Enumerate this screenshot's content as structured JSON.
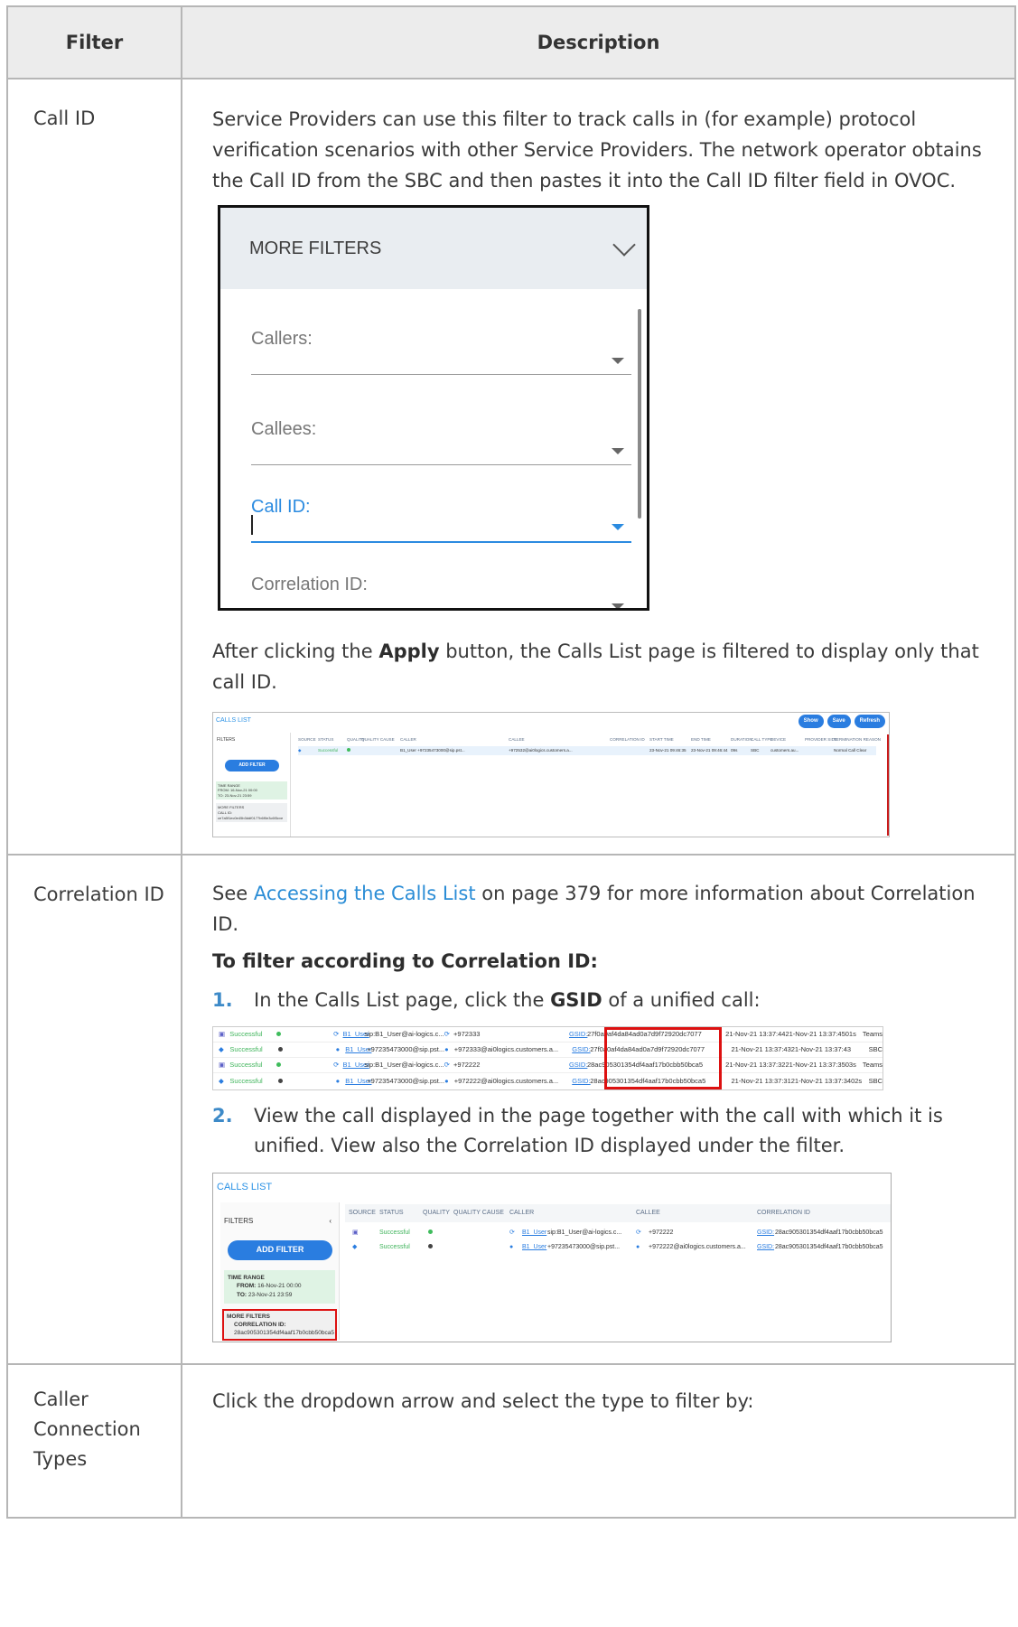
{
  "table": {
    "col_filter": "Filter",
    "col_description": "Description"
  },
  "rows": {
    "call_id": {
      "name": "Call ID",
      "para1": "Service Providers can use this filter to track calls in (for example) protocol verification scenarios with other Service Providers. The network operator obtains the Call ID from the SBC and then pastes it into the Call ID filter field in OVOC.",
      "para2_pre": "After clicking the ",
      "para2_bold": "Apply",
      "para2_post": " button, the Calls List page is filtered to display only that call ID."
    },
    "correlation_id": {
      "name": "Correlation ID",
      "see_pre": "See ",
      "see_link": "Accessing the Calls List",
      "see_post": " on page 379 for more information about Correlation ID.",
      "heading": "To filter according to Correlation ID:",
      "step1_num": "1.",
      "step1_pre": "In the Calls List page, click the ",
      "step1_bold": "GSID",
      "step1_post": " of a unified call:",
      "step2_num": "2.",
      "step2_text": "View the call displayed in the page together with the call with which it is unified. View also the Correlation ID displayed under the filter."
    },
    "caller_conn": {
      "name_l1": "Caller",
      "name_l2": "Connection",
      "name_l3": "Types",
      "text": "Click the dropdown arrow and select the type to filter by:"
    }
  },
  "more_filters": {
    "title": "MORE FILTERS",
    "fields": [
      "Callers:",
      "Callees:",
      "Call ID:",
      "Correlation ID:"
    ]
  },
  "calls_list_1": {
    "title": "CALLS LIST",
    "buttons": [
      "Show",
      "Save",
      "Refresh"
    ],
    "filters_label": "FILTERS",
    "add_filter": "ADD FILTER",
    "time_range": "TIME RANGE",
    "from": "FROM: 16-Nov-21 00:00",
    "to": "TO:    23-Nov-21 23:59",
    "more_filters": "MORE FILTERS",
    "call_id_label": "CALL ID:",
    "call_id_value": "ce7a5f1ec0e45b3ddf0177b6f0e3c6f3cve",
    "columns": [
      "SOURCE",
      "STATUS",
      "QUALITY",
      "QUALITY CAUSE",
      "CALLER",
      "CALLEE",
      "CORRELATION ID",
      "START TIME",
      "END TIME",
      "DURATION",
      "CALL TYPE",
      "DEVICE",
      "PROVIDER SIDE",
      "TERMINATION REASON"
    ],
    "row": {
      "status": "Successful",
      "caller": "B1_User +97235473000@sip.pst...",
      "callee": "+972532@ai0logics.customers.a...",
      "start": "23-Nov-21 09:46:35",
      "end": "23-Nov-21 09:46:44",
      "duration": "09s",
      "call_type": "SBC",
      "device": "customers.au...",
      "termination": "Normal Call Clear"
    }
  },
  "gsid_rows": [
    {
      "status": "Successful",
      "caller_link": "B1_User",
      "caller": "sip:B1_User@ai-logics.c...",
      "callee": "+972333",
      "gsid": "GSID:",
      "corr": "27f0a0af4da84ad0a7d9f72920dc7077",
      "start": "21-Nov-21 13:37:44",
      "end": "21-Nov-21 13:37:45",
      "dur": "01s",
      "type": "Teams"
    },
    {
      "status": "Successful",
      "caller_link": "B1_User",
      "caller": "+97235473000@sip.pst...",
      "callee": "+972333@ai0logics.customers.a...",
      "gsid": "GSID:",
      "corr": "27f0a0af4da84ad0a7d9f72920dc7077",
      "start": "21-Nov-21 13:37:43",
      "end": "21-Nov-21 13:37:43",
      "dur": "",
      "type": "SBC"
    },
    {
      "status": "Successful",
      "caller_link": "B1_User",
      "caller": "sip:B1_User@ai-logics.c...",
      "callee": "+972222",
      "gsid": "GSID:",
      "corr": "28ac905301354df4aaf17b0cbb50bca5",
      "start": "21-Nov-21 13:37:32",
      "end": "21-Nov-21 13:37:35",
      "dur": "03s",
      "type": "Teams"
    },
    {
      "status": "Successful",
      "caller_link": "B1_User",
      "caller": "+97235473000@sip.pst...",
      "callee": "+972222@ai0logics.customers.a...",
      "gsid": "GSID:",
      "corr": "28ac905301354df4aaf17b0cbb50bca5",
      "start": "21-Nov-21 13:37:31",
      "end": "21-Nov-21 13:37:34",
      "dur": "02s",
      "type": "SBC"
    }
  ],
  "calls_list_3": {
    "title": "CALLS LIST",
    "filters_label": "FILTERS",
    "add_filter": "ADD FILTER",
    "time_range": "TIME RANGE",
    "from_label": "FROM:",
    "from": "16-Nov-21 00:00",
    "to_label": "TO:",
    "to": "23-Nov-21 23:59",
    "more_filters": "MORE FILTERS",
    "corr_label": "CORRELATION ID:",
    "corr_value": "28ac905301354df4aaf17b0cbb50bca5",
    "columns": [
      "SOURCE",
      "STATUS",
      "QUALITY",
      "QUALITY CAUSE",
      "CALLER",
      "CALLEE",
      "CORRELATION ID"
    ],
    "rows": [
      {
        "status": "Successful",
        "caller_link": "B1_User",
        "caller": "sip:B1_User@ai-logics.c...",
        "callee": "+972222",
        "gsid": "GSID:",
        "corr": "28ac905301354df4aaf17b0cbb50bca5"
      },
      {
        "status": "Successful",
        "caller_link": "B1_User",
        "caller": "+97235473000@sip.pst...",
        "callee": "+972222@ai0logics.customers.a...",
        "gsid": "GSID:",
        "corr": "28ac905301354df4aaf17b0cbb50bca5"
      }
    ]
  },
  "colors": {
    "link": "#2b8dd6",
    "accent_blue": "#2a7de0",
    "success_green": "#3fb45b",
    "highlight_red": "#d11111"
  }
}
